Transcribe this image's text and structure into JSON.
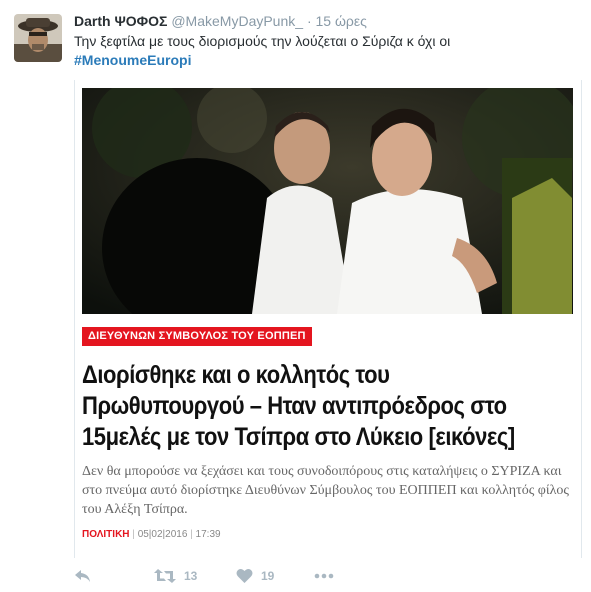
{
  "tweet": {
    "display_name": "Darth ΨΟΦΟΣ",
    "handle": "@MakeMyDayPunk_",
    "separator": "·",
    "time": "15 ώρες",
    "text": "Την ξεφτίλα με τους διορισμούς την λούζεται ο Σύριζα κ όχι οι",
    "hashtag": "#MenoumeEuropi"
  },
  "card": {
    "category": "ΔΙΕΥΘΥΝΩΝ ΣΥΜΒΟΥΛΟΣ ΤΟΥ ΕΟΠΠΕΠ",
    "headline_line1": "Διορίσθηκε και ο κολλητός του",
    "headline_line2": "Πρωθυπουργού – Ηταν αντιπρόεδρος στο",
    "headline_line3": "15μελές με τον Τσίπρα στο Λύκειο [εικόνες]",
    "summary": "Δεν θα μπορούσε να ξεχάσει και τους συνοδοιπόρους στις καταλήψεις ο ΣΥΡΙΖΑ και στο πνεύμα αυτό διορίστηκε Διευθύνων Σύμβουλος του ΕΟΠΠΕΠ και κολλητός φίλος του Αλέξη Τσίπρα.",
    "meta_category": "ΠΟΛΙΤΙΚΗ",
    "meta_sep": "|",
    "meta_date": "05|02|2016",
    "meta_time": "17:39"
  },
  "actions": {
    "retweet_count": "13",
    "like_count": "19"
  },
  "icons": {
    "reply": "reply-icon",
    "retweet": "retweet-icon",
    "like": "heart-icon",
    "more": "more-icon"
  },
  "colors": {
    "link": "#2b7bb9",
    "category_red": "#e4151f",
    "action_gray": "#aab8c2"
  }
}
